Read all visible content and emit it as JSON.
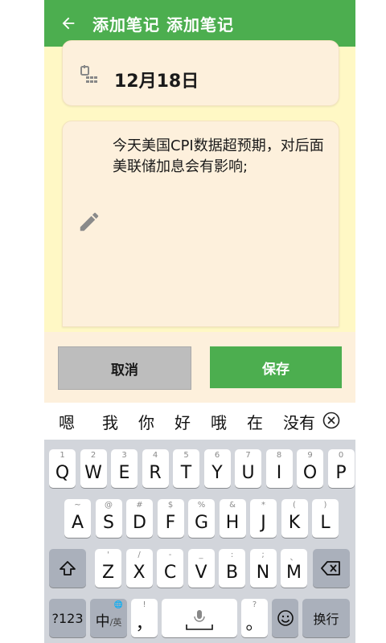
{
  "appbar": {
    "title": "添加笔记 添加笔记"
  },
  "date": {
    "text": "12月18日"
  },
  "note": {
    "text": "今天美国CPI数据超预期，对后面美联储加息会有影响;"
  },
  "buttons": {
    "cancel": "取消",
    "save": "保存"
  },
  "candidates": [
    "嗯",
    "我",
    "你",
    "好",
    "哦",
    "在",
    "没有"
  ],
  "keyboard": {
    "row1": [
      {
        "k": "Q",
        "s": "1"
      },
      {
        "k": "W",
        "s": "2"
      },
      {
        "k": "E",
        "s": "3"
      },
      {
        "k": "R",
        "s": "4"
      },
      {
        "k": "T",
        "s": "5"
      },
      {
        "k": "Y",
        "s": "6"
      },
      {
        "k": "U",
        "s": "7"
      },
      {
        "k": "I",
        "s": "8"
      },
      {
        "k": "O",
        "s": "9"
      },
      {
        "k": "P",
        "s": "0"
      }
    ],
    "row2": [
      {
        "k": "A",
        "s": "~"
      },
      {
        "k": "S",
        "s": "@"
      },
      {
        "k": "D",
        "s": "#"
      },
      {
        "k": "F",
        "s": "$"
      },
      {
        "k": "G",
        "s": "%"
      },
      {
        "k": "H",
        "s": "&"
      },
      {
        "k": "J",
        "s": "*"
      },
      {
        "k": "K",
        "s": "("
      },
      {
        "k": "L",
        "s": ")"
      }
    ],
    "row3": [
      {
        "k": "Z",
        "s": "'"
      },
      {
        "k": "X",
        "s": "/"
      },
      {
        "k": "C",
        "s": "-"
      },
      {
        "k": "V",
        "s": "_"
      },
      {
        "k": "B",
        "s": ":"
      },
      {
        "k": "N",
        "s": ";"
      },
      {
        "k": "M",
        "s": "、"
      }
    ],
    "num_key": "?123",
    "lang_key_main": "中",
    "lang_key_sub": "/英",
    "comma_sub": "!",
    "comma_main": "，",
    "period_sub": "?",
    "period_main": "。",
    "enter_key": "换行"
  },
  "colors": {
    "primary": "#4cae4f",
    "background": "#fff8c5",
    "card": "#fdf0dc"
  }
}
